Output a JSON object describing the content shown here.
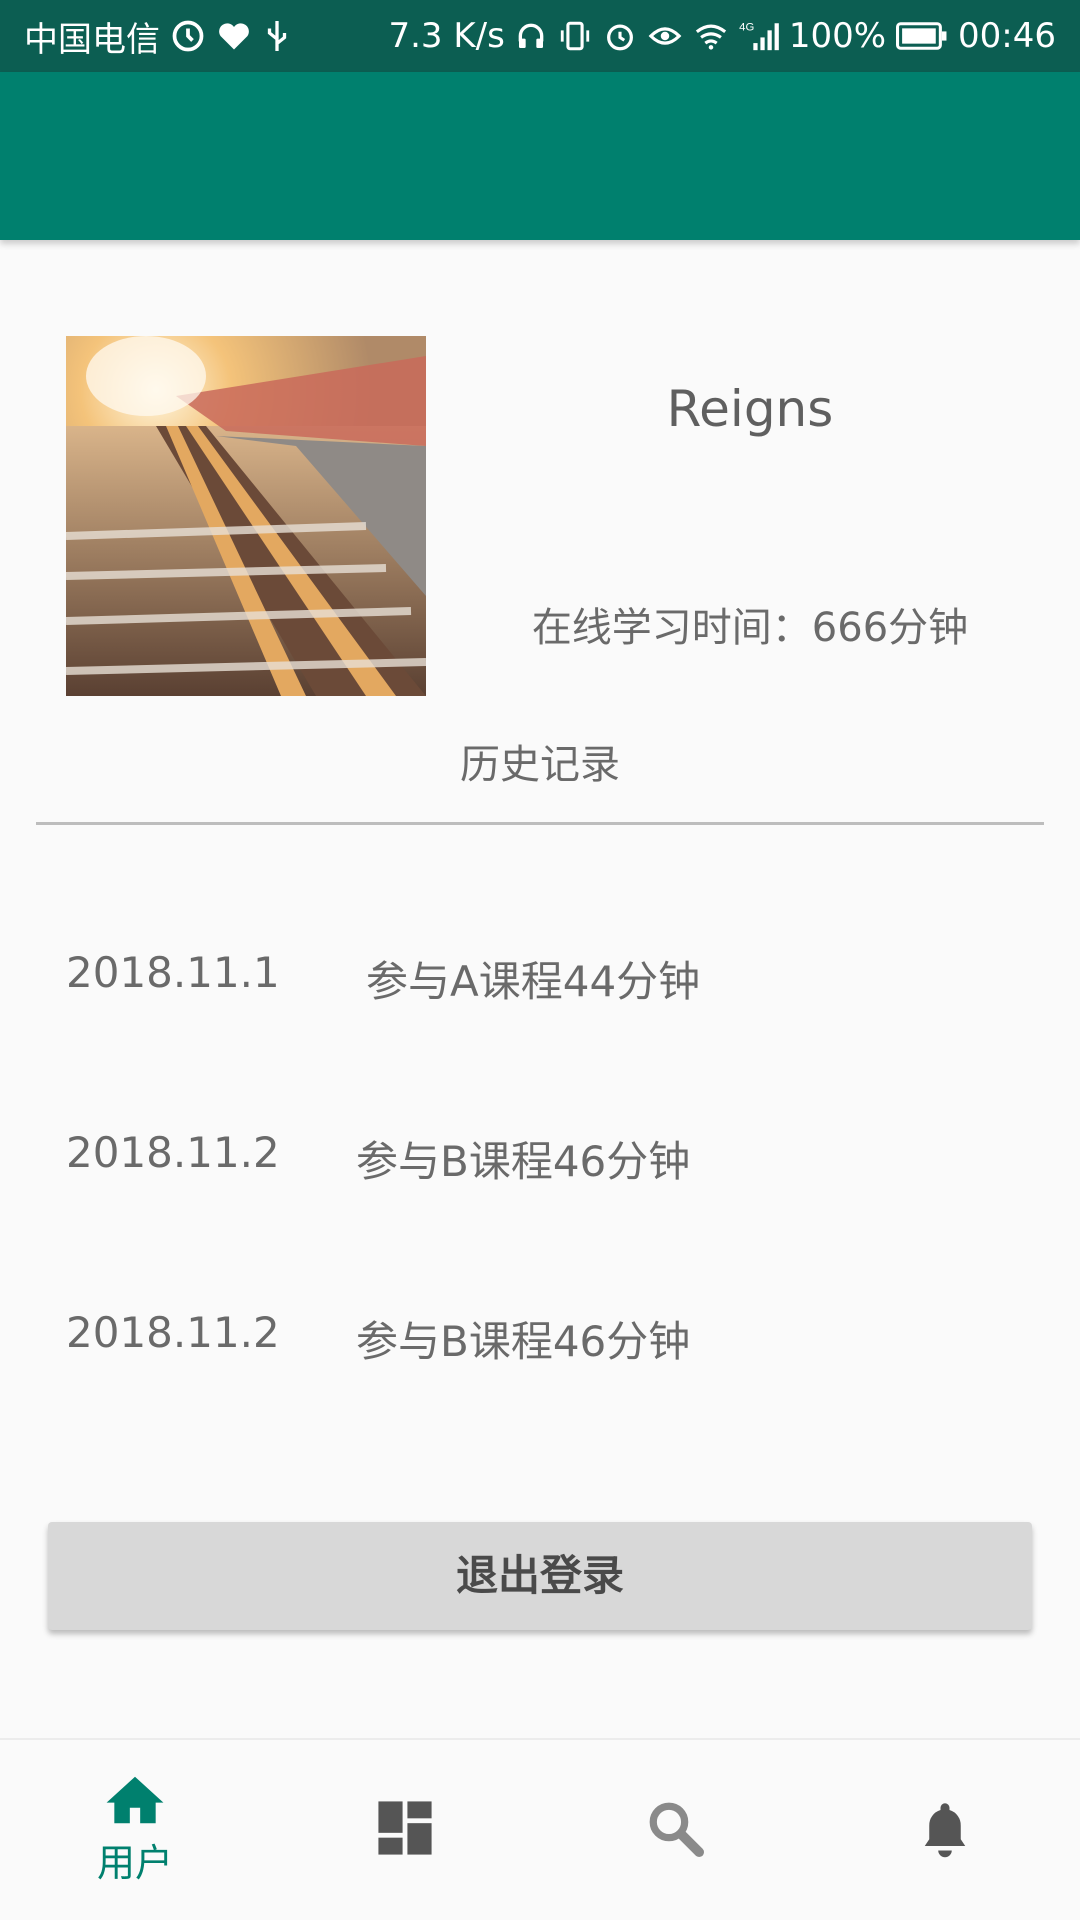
{
  "status_bar": {
    "carrier": "中国电信",
    "net_speed": "7.3 K/s",
    "network_type": "4G",
    "battery": "100%",
    "time": "00:46"
  },
  "colors": {
    "status_bar": "#0c5e52",
    "app_bar": "#00806e",
    "accent": "#00806e",
    "inactive_icon": "#555555"
  },
  "profile": {
    "username": "Reigns",
    "study_time": "在线学习时间：666分钟"
  },
  "history": {
    "title": "历史记录",
    "items": [
      {
        "date": "2018.11.1",
        "desc": "参与A课程44分钟"
      },
      {
        "date": "2018.11.2",
        "desc": "参与B课程46分钟"
      },
      {
        "date": "2018.11.2",
        "desc": "参与B课程46分钟"
      }
    ]
  },
  "logout_label": "退出登录",
  "bottom_nav": [
    {
      "icon": "home-icon",
      "label": "用户",
      "active": true
    },
    {
      "icon": "dashboard-icon",
      "active": false
    },
    {
      "icon": "search-icon",
      "active": false
    },
    {
      "icon": "bell-icon",
      "active": false
    }
  ]
}
